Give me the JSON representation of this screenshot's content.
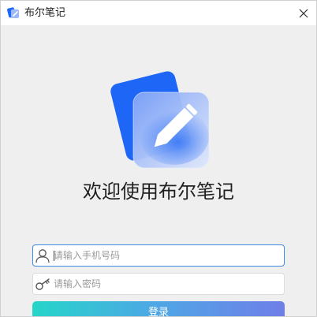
{
  "window": {
    "title": "布尔笔记",
    "close_glyph": "✕"
  },
  "icons": {
    "app": "notebook-pen-icon",
    "logo": "pen-card-logo",
    "username": "user-icon",
    "password": "key-icon",
    "close": "close-icon"
  },
  "colors": {
    "logo_back": "#1e66f5",
    "logo_front": "#8fb0f7",
    "input_focus_border": "#3d8ae0",
    "button_gradient": [
      "#25d5c9",
      "#4fa6e6",
      "#6f7ee8"
    ]
  },
  "main": {
    "welcome": "欢迎使用布尔笔记"
  },
  "form": {
    "username_placeholder": "请输入手机号码",
    "username_value": "",
    "password_placeholder": "请输入密码",
    "password_value": "",
    "login_label": "登录"
  }
}
